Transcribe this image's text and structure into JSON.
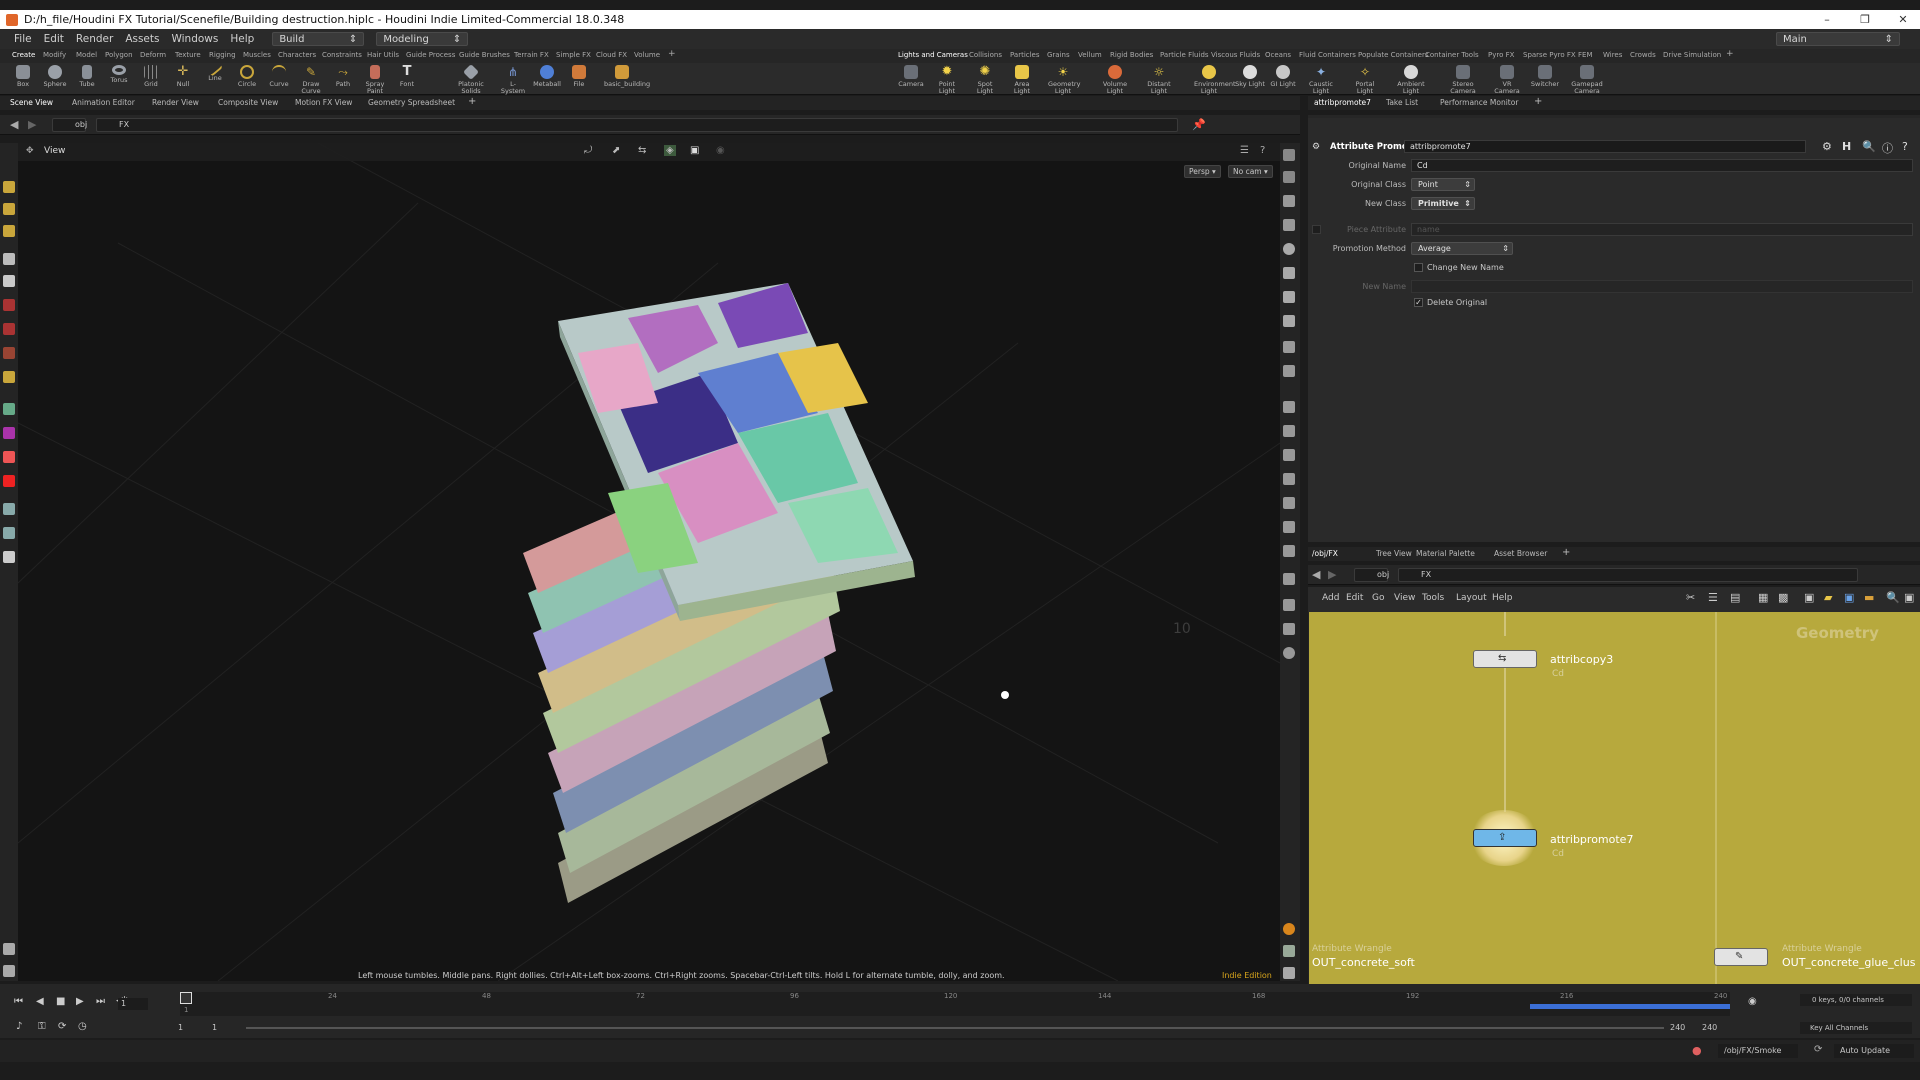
{
  "window": {
    "title": "D:/h_file/Houdini FX Tutorial/Scenefile/Building destruction.hiplc - Houdini Indie Limited-Commercial 18.0.348",
    "controls": [
      "–",
      "❐",
      "✕"
    ]
  },
  "menubar": {
    "items": [
      "File",
      "Edit",
      "Render",
      "Assets",
      "Windows",
      "Help"
    ],
    "desktop": "Build",
    "context": "Modeling",
    "workspace": "Main"
  },
  "shelf_tabs_left": [
    "Create",
    "Modify",
    "Model",
    "Polygon",
    "Deform",
    "Texture",
    "Rigging",
    "Muscles",
    "Characters",
    "Constraints",
    "Hair Utils",
    "Guide Process",
    "Guide Brushes",
    "Terrain FX",
    "Simple FX",
    "Cloud FX",
    "Volume",
    "+"
  ],
  "shelf_tabs_right": [
    "Lights and Cameras",
    "Collisions",
    "Particles",
    "Grains",
    "Vellum",
    "Rigid Bodies",
    "Particle Fluids",
    "Viscous Fluids",
    "Oceans",
    "Fluid Containers",
    "Populate Containers",
    "Container Tools",
    "Pyro FX",
    "Sparse Pyro FX",
    "FEM",
    "Wires",
    "Crowds",
    "Drive Simulation",
    "+"
  ],
  "shelf_tools_left": [
    "Box",
    "Sphere",
    "Tube",
    "Torus",
    "Grid",
    "Null",
    "Line",
    "Circle",
    "Curve",
    "Draw Curve",
    "Path",
    "Spray Paint",
    "Font",
    "Platonic Solids",
    "L-System",
    "Metaball",
    "File",
    "basic_building"
  ],
  "shelf_tools_right": [
    "Camera",
    "Point Light",
    "Spot Light",
    "Area Light",
    "Geometry Light",
    "Volume Light",
    "Distant Light",
    "Environment Light",
    "Sky Light",
    "GI Light",
    "Caustic Light",
    "Portal Light",
    "Ambient Light",
    "Stereo Camera",
    "VR Camera",
    "Switcher",
    "Gamepad Camera"
  ],
  "left_pane_tabs": [
    "Scene View",
    "Animation Editor",
    "Render View",
    "Composite View",
    "Motion FX View",
    "Geometry Spreadsheet",
    "+"
  ],
  "right_pane_tabs": [
    "attribpromote7",
    "Take List",
    "Performance Monitor",
    "+"
  ],
  "path": {
    "obj": "obj",
    "node": "FX"
  },
  "viewport": {
    "title": "View",
    "persp": "Persp ▾",
    "cam": "No cam ▾",
    "hint": "Left mouse tumbles. Middle pans. Right dollies. Ctrl+Alt+Left box-zooms. Ctrl+Right zooms. Spacebar-Ctrl-Left tilts. Hold L for alternate tumble, dolly, and zoom.",
    "edition": "Indie Edition",
    "grid_label": "10"
  },
  "params": {
    "node_type": "Attribute Promote",
    "node_name": "attribpromote7",
    "original_name_label": "Original Name",
    "original_name": "Cd",
    "original_class_label": "Original Class",
    "original_class": "Point",
    "new_class_label": "New Class",
    "new_class": "Primitive",
    "piece_attr_label": "Piece Attribute",
    "piece_attr": "name",
    "method_label": "Promotion Method",
    "method": "Average",
    "change_name_label": "Change New Name",
    "new_name_label": "New Name",
    "delete_original_label": "Delete Original",
    "delete_original": true
  },
  "network_tabs": [
    "/obj/FX",
    "Tree View",
    "Material Palette",
    "Asset Browser",
    "+"
  ],
  "network_menu": [
    "Add",
    "Edit",
    "Go",
    "View",
    "Tools",
    "Layout",
    "Help"
  ],
  "network": {
    "context_label": "Geometry",
    "nodes": [
      {
        "name": "attribcopy3",
        "sub": "Cd"
      },
      {
        "name": "attribpromote7",
        "sub": "Cd"
      }
    ],
    "bottom_left": {
      "type": "Attribute Wrangle",
      "name": "OUT_concrete_soft"
    },
    "bottom_right": {
      "type": "Attribute Wrangle",
      "name": "OUT_concrete_glue_clus"
    }
  },
  "timeline": {
    "ticks": [
      "1",
      "24",
      "48",
      "72",
      "96",
      "120",
      "144",
      "168",
      "192",
      "216",
      "240"
    ],
    "current_frame": "1",
    "start": "1",
    "start2": "1",
    "end": "240",
    "end2": "240",
    "keys_info": "0 keys, 0/0 channels",
    "key_all": "Key All Channels"
  },
  "status": {
    "path": "/obj/FX/Smoke",
    "update": "Auto Update"
  }
}
